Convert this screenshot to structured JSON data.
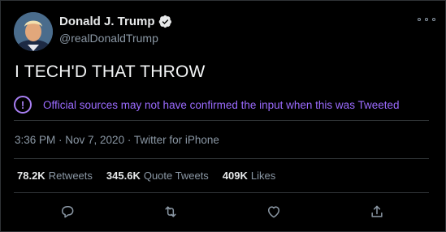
{
  "author": {
    "display_name": "Donald J. Trump",
    "handle": "@realDonaldTrump",
    "verified": true
  },
  "tweet": {
    "text": "I TECH'D THAT THROW"
  },
  "notice": {
    "icon_glyph": "!",
    "text": "Official sources may not have confirmed the input when this was Tweeted",
    "color": "#9b6bff"
  },
  "meta": {
    "timestamp": "3:36 PM · Nov 7, 2020 · Twitter for iPhone"
  },
  "stats": [
    {
      "count": "78.2K",
      "label": "Retweets"
    },
    {
      "count": "345.6K",
      "label": "Quote Tweets"
    },
    {
      "count": "409K",
      "label": "Likes"
    }
  ],
  "icons": {
    "avatar": "avatar-photo",
    "verified": "verified-badge-icon",
    "more": "more-options-icon",
    "reply": "reply-icon",
    "retweet": "retweet-icon",
    "like": "heart-icon",
    "share": "share-icon"
  },
  "colors": {
    "background": "#000000",
    "divider": "#2f3336",
    "secondary_text": "#8b98a5",
    "verified": "#e7e9ea"
  }
}
